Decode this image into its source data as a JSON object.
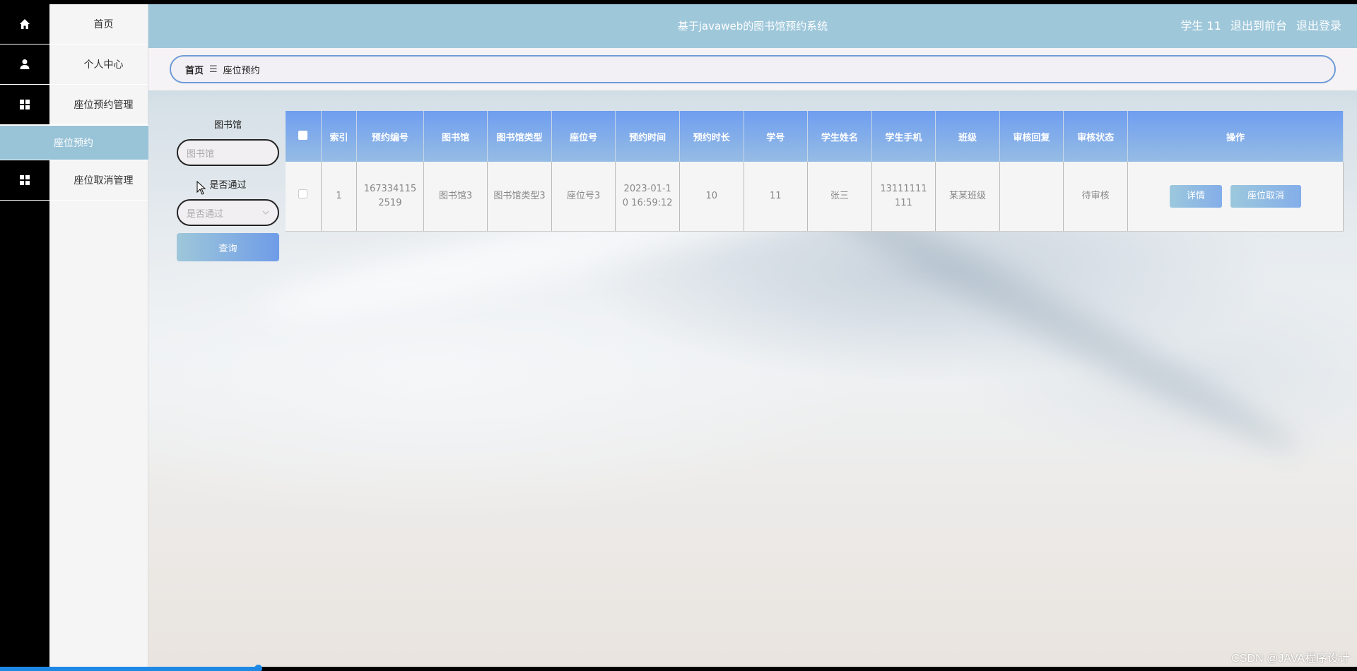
{
  "header": {
    "system_title": "基于javaweb的图书馆预约系统",
    "user_label": "学生 11",
    "front_label": "退出到前台",
    "logout_label": "退出登录"
  },
  "sidebar": {
    "items": [
      {
        "label": "首页",
        "icon": "home-icon"
      },
      {
        "label": "个人中心",
        "icon": "user-icon"
      },
      {
        "label": "座位预约管理",
        "icon": "grid-icon"
      },
      {
        "label": "座位预约",
        "icon": ""
      },
      {
        "label": "座位取消管理",
        "icon": "grid-icon"
      }
    ]
  },
  "breadcrumb": {
    "home": "首页",
    "separator": "☰",
    "current": "座位预约"
  },
  "search": {
    "library_label": "图书馆",
    "library_placeholder": "图书馆",
    "approved_label": "是否通过",
    "approved_placeholder": "是否通过",
    "query_button": "查询"
  },
  "table": {
    "headers": [
      "",
      "索引",
      "预约编号",
      "图书馆",
      "图书馆类型",
      "座位号",
      "预约时间",
      "预约时长",
      "学号",
      "学生姓名",
      "学生手机",
      "班级",
      "审核回复",
      "审核状态",
      "操作"
    ],
    "rows": [
      {
        "index": "1",
        "booking_no": "1673341152519",
        "library": "图书馆3",
        "library_type": "图书馆类型3",
        "seat_no": "座位号3",
        "booking_time": "2023-01-10 16:59:12",
        "duration": "10",
        "student_id": "11",
        "student_name": "张三",
        "phone": "13111111111",
        "class": "某某班级",
        "review_reply": "",
        "review_status": "待审核",
        "detail_button": "详情",
        "cancel_button": "座位取消"
      }
    ]
  },
  "watermark": "CSDN @JAVA程序设计",
  "video_progress": 0.19,
  "colors": {
    "topbar": "#9ec7da",
    "table_header": "#6f9ef0",
    "submenu_active": "#99c3d7",
    "breadcrumb_border": "#6f9bd8"
  }
}
